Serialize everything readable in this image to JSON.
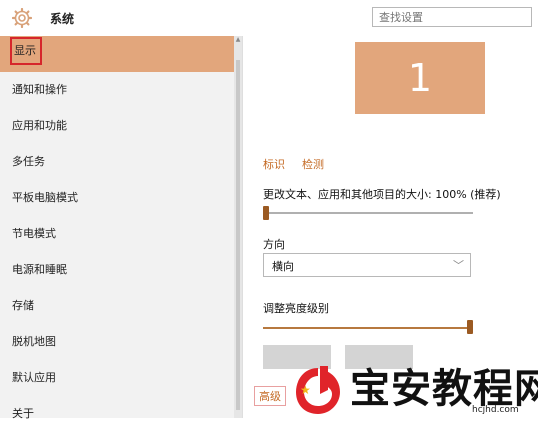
{
  "header": {
    "title": "系统",
    "search_placeholder": "查找设置",
    "icon": "gear-icon"
  },
  "sidebar": {
    "items": [
      {
        "label": "显示",
        "active": true
      },
      {
        "label": "通知和操作"
      },
      {
        "label": "应用和功能"
      },
      {
        "label": "多任务"
      },
      {
        "label": "平板电脑模式"
      },
      {
        "label": "节电模式"
      },
      {
        "label": "电源和睡眠"
      },
      {
        "label": "存储"
      },
      {
        "label": "脱机地图"
      },
      {
        "label": "默认应用"
      },
      {
        "label": "关于"
      }
    ]
  },
  "main": {
    "monitor_number": "1",
    "identify_link": "标识",
    "detect_link": "检测",
    "scale_label": "更改文本、应用和其他项目的大小: 100% (推荐)",
    "scale_value_percent": 100,
    "orientation_label": "方向",
    "orientation_value": "横向",
    "brightness_label": "调整亮度级别",
    "brightness_level": 1.0,
    "advanced_link": "高级"
  },
  "watermark": {
    "text": "宝安教程网",
    "url": "hcjhd.com"
  },
  "colors": {
    "accent": "#e2a67c",
    "sidebar_bg": "#f2f2f2",
    "link": "#c46a24",
    "highlight_border": "#d6262b",
    "watermark_red": "#e0242a"
  }
}
